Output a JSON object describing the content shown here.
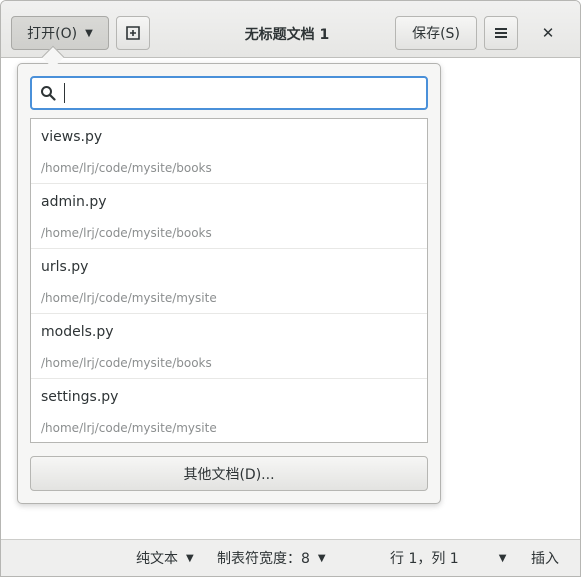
{
  "header": {
    "open_label": "打开(O)",
    "title": "无标题文档 1",
    "save_label": "保存(S)"
  },
  "icons": {
    "open_caret": "chevron-down-icon",
    "new_tab": "new-tab-icon",
    "menu": "hamburger-menu-icon",
    "close": "close-icon",
    "search": "search-icon"
  },
  "popover": {
    "search": {
      "value": "",
      "placeholder": ""
    },
    "recent_files": [
      {
        "name": "views.py",
        "path": "/home/lrj/code/mysite/books"
      },
      {
        "name": "admin.py",
        "path": "/home/lrj/code/mysite/books"
      },
      {
        "name": "urls.py",
        "path": "/home/lrj/code/mysite/mysite"
      },
      {
        "name": "models.py",
        "path": "/home/lrj/code/mysite/books"
      },
      {
        "name": "settings.py",
        "path": "/home/lrj/code/mysite/mysite"
      }
    ],
    "other_documents_label": "其他文档(D)..."
  },
  "statusbar": {
    "language": "纯文本",
    "tab_width": "制表符宽度：8",
    "position": "行 1，列 1",
    "mode": "插入"
  },
  "colors": {
    "accent": "#4a90d9",
    "headerbar": "#e8e8e7",
    "path_text": "#8b8e8f"
  }
}
